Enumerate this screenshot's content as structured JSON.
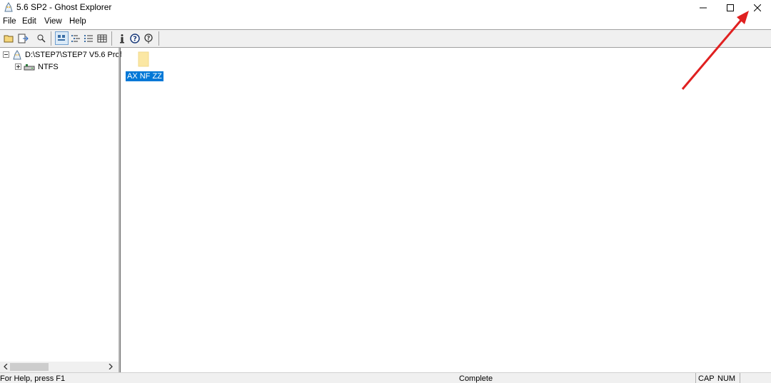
{
  "window": {
    "title": "5.6 SP2 - Ghost Explorer",
    "controls": {
      "minimize": "minimize",
      "maximize": "maximize",
      "close": "close"
    }
  },
  "menu": [
    "File",
    "Edit",
    "View",
    "Help"
  ],
  "toolbar": {
    "buttons": [
      "open-icon",
      "extract-icon",
      "find-icon",
      "large-icons-icon",
      "list-view-icon",
      "details-view-icon",
      "grid-view-icon",
      "info-icon",
      "help-icon",
      "context-help-icon"
    ]
  },
  "tree": {
    "root_label": "D:\\STEP7\\STEP7 V5.6 Prof",
    "child_label": "NTFS"
  },
  "file_list": {
    "items": [
      {
        "name": "AX NF ZZ",
        "type": "folder",
        "selected": true
      }
    ]
  },
  "statusbar": {
    "help_text": "For Help, press F1",
    "status_text": "Complete",
    "cap": "CAP",
    "num": "NUM"
  },
  "colors": {
    "selection": "#0078d7",
    "folder": "#fbe7a3",
    "annotation_arrow": "#e02020"
  }
}
